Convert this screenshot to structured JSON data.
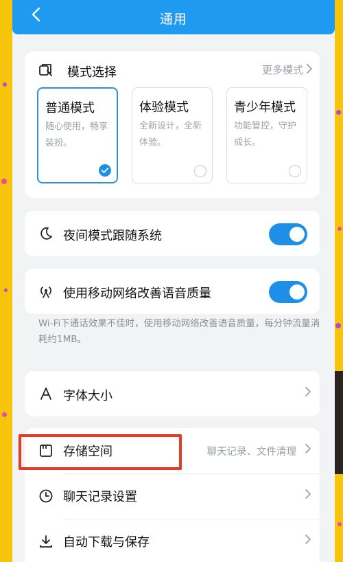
{
  "header": {
    "title": "通用"
  },
  "mode_section": {
    "title": "模式选择",
    "more_label": "更多模式",
    "modes": [
      {
        "name": "普通模式",
        "desc": "随心使用，畅享装扮。",
        "selected": true
      },
      {
        "name": "体验模式",
        "desc": "全新设计，全新体验。",
        "selected": false
      },
      {
        "name": "青少年模式",
        "desc": "功能管控，守护成长。",
        "selected": false
      }
    ]
  },
  "night_mode": {
    "label": "夜间模式跟随系统",
    "enabled": true
  },
  "mobile_network": {
    "label": "使用移动网络改善语音质量",
    "enabled": true,
    "note": "Wi-Fi下通话效果不佳时，使用移动网络改善语音质量，每分钟流量消耗约1MB。"
  },
  "font_size": {
    "label": "字体大小"
  },
  "list": {
    "storage": {
      "label": "存储空间",
      "sub": "聊天记录、文件清理"
    },
    "chat_history": {
      "label": "聊天记录设置"
    },
    "auto_download": {
      "label": "自动下载与保存"
    }
  },
  "colors": {
    "accent": "#1e8fe6",
    "topbar": "#1e9bf0",
    "highlight": "#e53a26",
    "frame": "#f6c40a"
  }
}
